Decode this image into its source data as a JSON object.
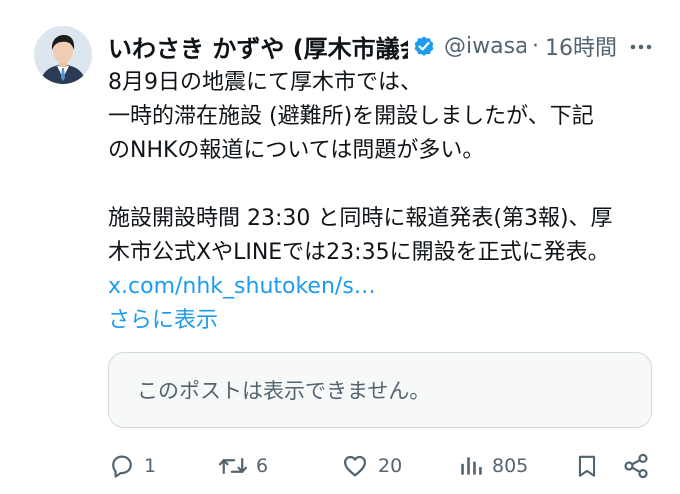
{
  "post": {
    "author": {
      "display_name": "いわさき かずや (厚木市議会議員)",
      "handle": "@iwasaki",
      "verified": true,
      "avatar": "person-avatar"
    },
    "separator": "·",
    "timestamp": "16時間",
    "text_lines": [
      "8月9日の地震にて厚木市では、",
      "一時的滞在施設 (避難所)を開設しましたが、下記",
      "のNHKの報道については問題が多い。",
      "",
      "施設開設時間 23:30 と同時に報道発表(第3報)、厚",
      "木市公式XやLINEでは23:35に開設を正式に発表。"
    ],
    "link_text": "x.com/nhk_shutoken/s…",
    "show_more": "さらに表示",
    "quote_unavailable": "このポストは表示できません。",
    "actions": {
      "reply_count": "1",
      "repost_count": "6",
      "like_count": "20",
      "views_count": "805"
    },
    "icons": {
      "more": "more-icon",
      "verified": "verified-badge-icon",
      "reply": "reply-icon",
      "repost": "repost-icon",
      "like": "heart-icon",
      "views": "views-icon",
      "bookmark": "bookmark-icon",
      "share": "share-icon"
    },
    "colors": {
      "text": "#0f1419",
      "secondary": "#536471",
      "link": "#1d9bf0",
      "verified": "#1d9bf0",
      "card_bg": "#f7f9f9",
      "card_border": "#cfd9de"
    }
  }
}
